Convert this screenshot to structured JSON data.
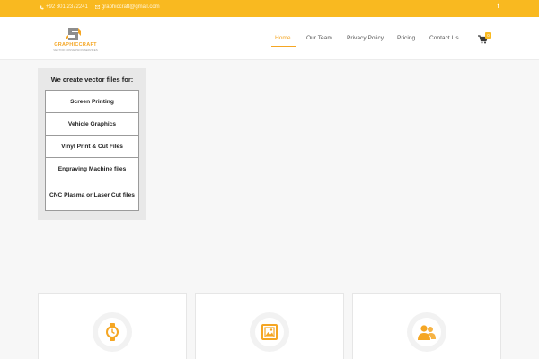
{
  "topbar": {
    "phone": "+92 301 2372241",
    "email": "graphiccraft@gmail.com",
    "social": "f"
  },
  "brand": {
    "name": "GRAPHICCRAFT",
    "tagline": "VECTOR CONVERSION SERVICES",
    "accent": "#f5a623",
    "topbar_color": "#f9b920"
  },
  "nav": {
    "items": [
      {
        "label": "Home",
        "active": true
      },
      {
        "label": "Our Team",
        "active": false
      },
      {
        "label": "Privacy Policy",
        "active": false
      },
      {
        "label": "Pricing",
        "active": false
      },
      {
        "label": "Contact Us",
        "active": false
      }
    ],
    "cart_count": "0"
  },
  "services": {
    "title": "We create vector files for:",
    "items": [
      "Screen Printing",
      "Vehicle Graphics",
      "Vinyl Print & Cut Files",
      "Engraving Machine files",
      "CNC Plasma or Laser Cut files"
    ]
  },
  "features": [
    {
      "icon": "watch-icon"
    },
    {
      "icon": "image-frame-icon"
    },
    {
      "icon": "users-icon"
    }
  ]
}
